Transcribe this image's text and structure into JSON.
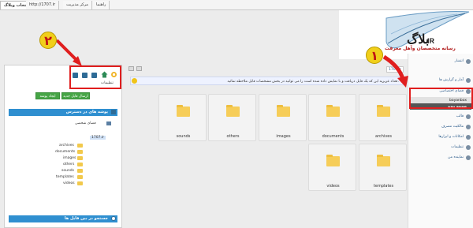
{
  "topbar": {
    "tabs": [
      "انتخاب ویلاگ",
      "http://1707.ir",
      "مرکز مدیریت",
      "راهنما"
    ]
  },
  "logo": {
    "title": "IR",
    "subtitle": "رسانه متخصصان وآهل معرفت"
  },
  "rightnav": {
    "items": [
      "انتشار",
      "آمار و گزارش ها",
      "فضای اختصاصی",
      "bayanbox",
      "قالب",
      "مالکیت مصرف",
      "امکانات و ابزارها",
      "تنظیمات",
      "نماینده من"
    ],
    "sub_label": "ضمیمه پیوند"
  },
  "left": {
    "tools_label": "تنظیمات",
    "btn_send": "ارسال فایل جدید",
    "btn_folder": "ایجاد پوشه جدید",
    "access_header": "پوشه های در دسترس",
    "personal_space": "فضای شخصی",
    "root": "1707.ir",
    "folders": [
      "archives",
      "documents",
      "images",
      "others",
      "sounds",
      "templates",
      "videos"
    ],
    "search_header": "جستجو در بین فایل ها"
  },
  "main": {
    "path": "1707.ir",
    "notice": "تعداد عزیزیه این که یک فایل دریافت و با نمایش داده شده است را می توانید در بخش مشخصات فایل ملاحظه نمائید.",
    "folders": [
      "sounds",
      "others",
      "images",
      "documents",
      "archives",
      "videos",
      "templates"
    ]
  },
  "annotations": {
    "badge1": "۱",
    "badge2": "۲"
  }
}
